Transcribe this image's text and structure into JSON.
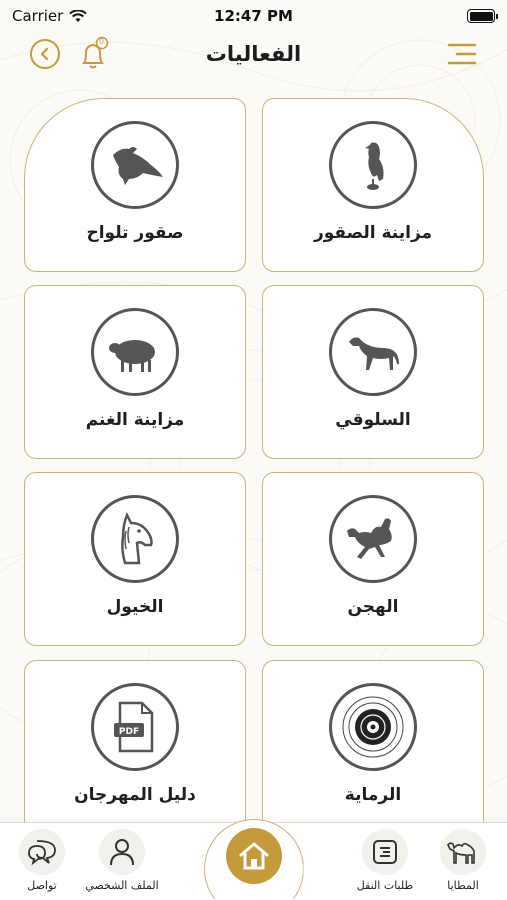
{
  "status_bar": {
    "carrier": "Carrier",
    "time": "12:47 PM"
  },
  "header": {
    "title": "الفعاليات",
    "notification_count": "0"
  },
  "grid": [
    {
      "label": "مزاينة الصقور",
      "icon": "falcon-icon"
    },
    {
      "label": "صقور تلواح",
      "icon": "falcon-fly-icon"
    },
    {
      "label": "السلوقي",
      "icon": "saluki-dog-icon"
    },
    {
      "label": "مزاينة الغنم",
      "icon": "sheep-icon"
    },
    {
      "label": "الهجن",
      "icon": "camel-race-icon"
    },
    {
      "label": "الخيول",
      "icon": "horse-icon"
    },
    {
      "label": "الرماية",
      "icon": "target-icon"
    },
    {
      "label": "دليل المهرجان",
      "icon": "pdf-icon"
    }
  ],
  "bottom_nav": {
    "items": [
      {
        "label": "المطايا",
        "icon": "camel-icon"
      },
      {
        "label": "طلبات النقل",
        "icon": "list-icon"
      },
      {
        "label": "الملف الشخصي",
        "icon": "user-icon"
      },
      {
        "label": "تواصل",
        "icon": "chat-icon"
      }
    ],
    "home_icon": "home-icon"
  },
  "colors": {
    "accent": "#c59a3a",
    "card_border": "#cdb276",
    "icon_gray": "#555555"
  }
}
